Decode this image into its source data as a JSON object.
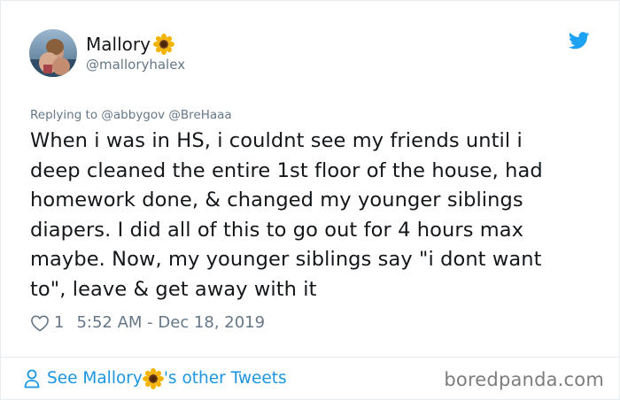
{
  "user": {
    "display_name": "Mallory",
    "name_emoji": "sunflower-icon",
    "handle": "@malloryhalex"
  },
  "reply": {
    "prefix": "Replying to",
    "mentions": "@abbygov @BreHaaa"
  },
  "tweet": {
    "text": "When i was in HS, i couldnt see my friends until i\ndeep cleaned the entire 1st floor of the house, had\nhomework done, & changed my younger siblings\ndiapers. I did all of this to go out for 4 hours max\nmaybe. Now, my younger siblings say \"i dont want\nto\", leave & get away with it",
    "like_count": "1",
    "timestamp": "5:52 AM - Dec 18, 2019"
  },
  "footer": {
    "link_prefix": "See Mallory",
    "link_suffix": "'s other Tweets",
    "watermark": "boredpanda.com"
  },
  "colors": {
    "twitter_blue": "#1da1f2",
    "link_blue": "#1b95e0",
    "secondary_text": "#657786",
    "sunflower_petal": "#f5b301",
    "sunflower_center": "#6b3a12"
  },
  "icons": {
    "brand": "twitter-bird-icon",
    "like": "heart-outline-icon",
    "profile": "person-icon"
  }
}
